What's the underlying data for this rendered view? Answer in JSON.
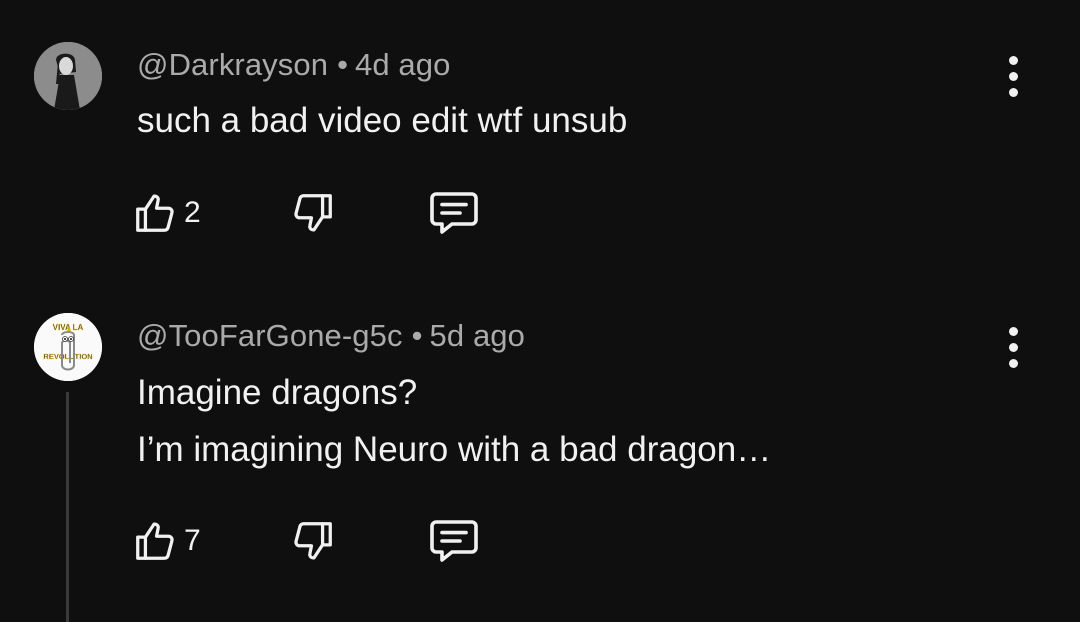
{
  "comments": [
    {
      "author": "@Darkrayson",
      "separator": "•",
      "time": "4d ago",
      "text_lines": [
        "such a bad video edit wtf unsub"
      ],
      "likes": "2",
      "avatar_icon": "profile-photo-person",
      "has_thread_line": false
    },
    {
      "author": "@TooFarGone-g5c",
      "separator": "•",
      "time": "5d ago",
      "text_lines": [
        "Imagine dragons?",
        "I’m imagining Neuro with a bad dragon…"
      ],
      "likes": "7",
      "avatar_icon": "viva-la-revolution-clippy",
      "avatar_text": [
        "VIVA LA",
        "REVOLUTION"
      ],
      "has_thread_line": true
    }
  ],
  "icons": {
    "like": "thumbs-up-outline-icon",
    "dislike": "thumbs-down-outline-icon",
    "reply": "comment-reply-icon",
    "menu": "more-vertical-icon"
  },
  "colors": {
    "background": "#0f0f0f",
    "primary_text": "#f1f1f1",
    "secondary_text": "#aaaaaa",
    "thread_line": "#3a3a3a"
  }
}
